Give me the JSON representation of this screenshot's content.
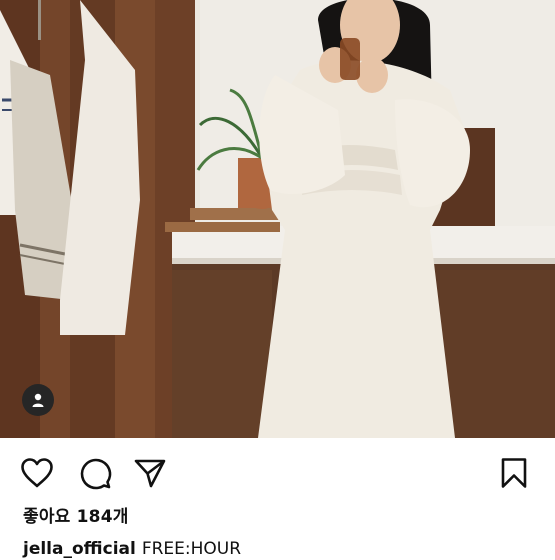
{
  "post": {
    "likes_text": "좋아요 184개",
    "username": "jella_official",
    "caption": "FREE:HOUR"
  },
  "actions": {
    "like_icon": "heart-icon",
    "comment_icon": "comment-icon",
    "share_icon": "paper-plane-icon",
    "save_icon": "bookmark-icon"
  },
  "photo": {
    "tag_icon": "person-icon"
  }
}
